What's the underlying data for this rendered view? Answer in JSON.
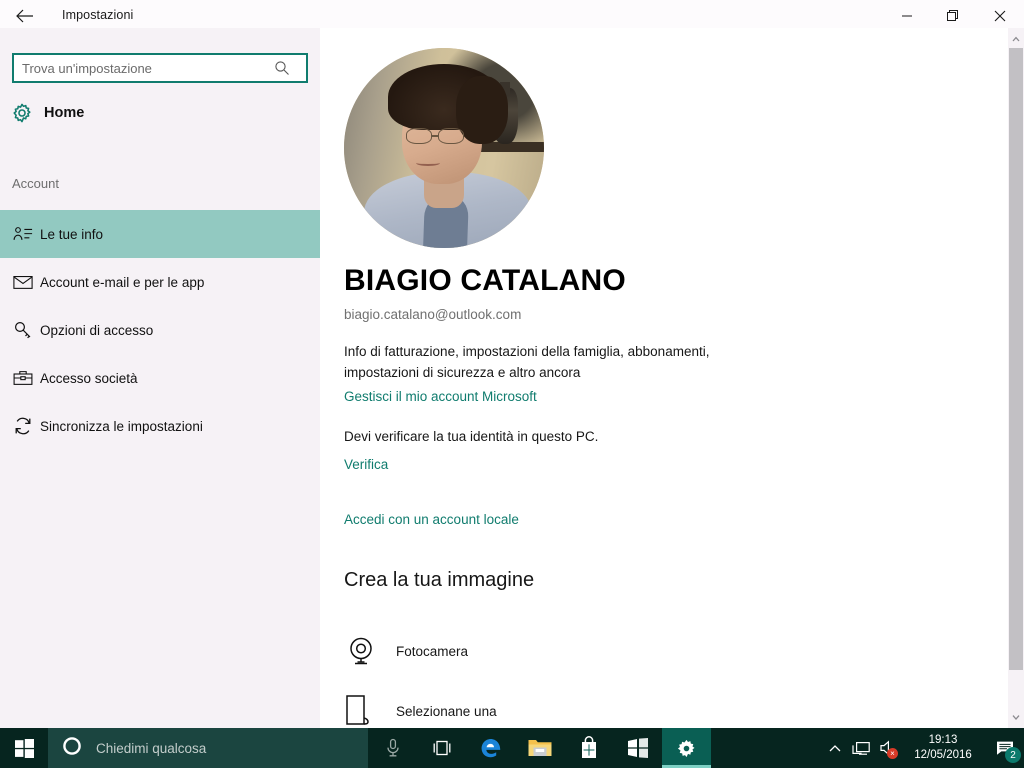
{
  "window": {
    "title": "Impostazioni",
    "back_icon": "back-arrow-icon",
    "minimize_label": "—",
    "restore_label": "❐",
    "close_label": "✕"
  },
  "sidebar": {
    "search": {
      "placeholder": "Trova un'impostazione",
      "value": "",
      "icon": "search-icon"
    },
    "home": {
      "label": "Home",
      "icon": "gear-icon"
    },
    "group_title": "Account",
    "items": [
      {
        "label": "Le tue info",
        "icon": "user-info-icon",
        "selected": true
      },
      {
        "label": "Account e-mail e per le app",
        "icon": "envelope-icon",
        "selected": false
      },
      {
        "label": "Opzioni di accesso",
        "icon": "key-icon",
        "selected": false
      },
      {
        "label": "Accesso società",
        "icon": "briefcase-icon",
        "selected": false
      },
      {
        "label": "Sincronizza le impostazioni",
        "icon": "sync-icon",
        "selected": false
      }
    ]
  },
  "main": {
    "avatar_alt": "user-avatar-photo",
    "user_name": "BIAGIO CATALANO",
    "user_email": "biagio.catalano@outlook.com",
    "description": "Info di fatturazione, impostazioni della famiglia, abbonamenti, impostazioni di sicurezza e altro ancora",
    "manage_link": "Gestisci il mio account Microsoft",
    "verify_text": "Devi verificare la tua identità in questo PC.",
    "verify_link": "Verifica",
    "local_account_link": "Accedi con un account locale",
    "picture_section_title": "Crea la tua immagine",
    "picture_options": [
      {
        "label": "Fotocamera",
        "icon": "webcam-icon"
      },
      {
        "label": "Selezionane una",
        "icon": "browse-file-icon"
      }
    ]
  },
  "scrollbar": {
    "up_icon": "chevron-up-icon",
    "down_icon": "chevron-down-icon"
  },
  "taskbar": {
    "start_icon": "windows-logo-icon",
    "cortana": {
      "placeholder": "Chiedimi qualcosa",
      "circle_icon": "cortana-circle-icon",
      "mic_icon": "microphone-icon"
    },
    "apps": [
      {
        "name": "task-view",
        "icon": "task-view-icon",
        "active": false
      },
      {
        "name": "microsoft-edge",
        "icon": "edge-icon",
        "active": false
      },
      {
        "name": "file-explorer",
        "icon": "folder-icon",
        "active": false
      },
      {
        "name": "microsoft-store",
        "icon": "store-bag-icon",
        "active": false
      },
      {
        "name": "windows-app",
        "icon": "windows-flag-icon",
        "active": false
      },
      {
        "name": "settings",
        "icon": "gear-icon",
        "active": true
      }
    ],
    "tray": {
      "show_hidden_icon": "chevron-up-icon",
      "network_icon": "network-monitor-icon",
      "volume_icon": "speaker-muted-icon",
      "mute_mark": "×",
      "time": "19:13",
      "date": "12/05/2016",
      "action_center_icon": "action-center-icon",
      "notification_count": "2"
    }
  },
  "colors": {
    "accent_teal": "#107c6e",
    "selection_mint": "#92c9c1",
    "sidebar_bg": "#f6f2f6",
    "taskbar_bg": "#06251f",
    "taskbar_active": "#0a5f54",
    "cortana_bg": "#1b4540",
    "scrollbar_thumb": "#c2c0c4"
  }
}
